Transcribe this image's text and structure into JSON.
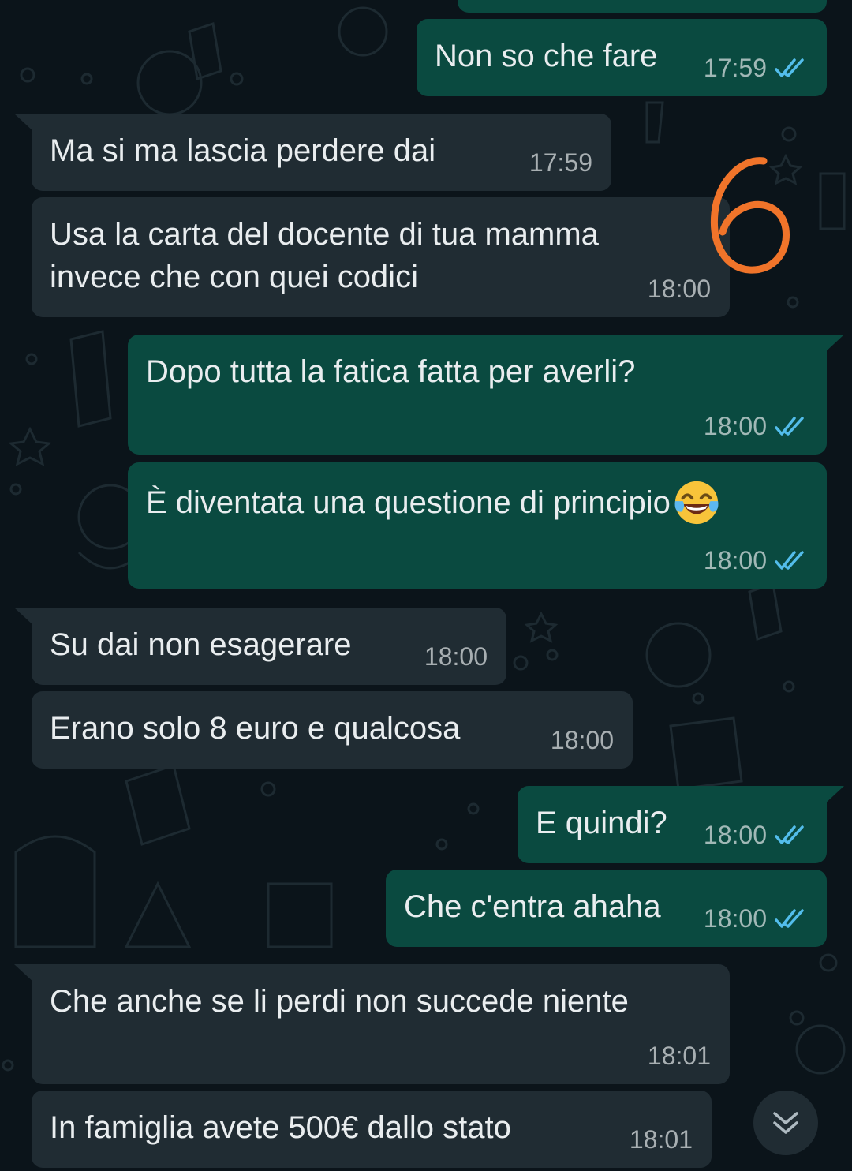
{
  "theme": {
    "background": "#0b141a",
    "incoming_bubble": "#202c33",
    "outgoing_bubble": "#0a4a40",
    "read_ticks": "#53bdeb",
    "annotation": "#f0742a"
  },
  "messages": [
    {
      "direction": "out",
      "text": "Non so che fare",
      "time": "17:59",
      "status": "read-ticks-icon"
    },
    {
      "direction": "in",
      "text": "Ma si ma lascia perdere dai",
      "time": "17:59"
    },
    {
      "direction": "in",
      "text_line1": "Usa la carta del docente di tua mamma",
      "text_line2": "invece che con quei codici",
      "time": "18:00"
    },
    {
      "direction": "out",
      "text": "Dopo tutta la fatica fatta per averli?",
      "time": "18:00",
      "status": "read-ticks-icon"
    },
    {
      "direction": "out",
      "text": "È diventata una questione di principio",
      "emoji": "laughing-tears-emoji",
      "time": "18:00",
      "status": "read-ticks-icon"
    },
    {
      "direction": "in",
      "text": "Su dai non esagerare",
      "time": "18:00"
    },
    {
      "direction": "in",
      "text": "Erano solo 8 euro e qualcosa",
      "time": "18:00"
    },
    {
      "direction": "out",
      "text": "E quindi?",
      "time": "18:00",
      "status": "read-ticks-icon"
    },
    {
      "direction": "out",
      "text": "Che c'entra ahaha",
      "time": "18:00",
      "status": "read-ticks-icon"
    },
    {
      "direction": "in",
      "text": "Che anche se li perdi non succede niente",
      "time": "18:01"
    },
    {
      "direction": "in",
      "text": "In famiglia avete 500€ dallo stato",
      "time": "18:01"
    }
  ],
  "scroll_button": {
    "icon": "double-chevron-down-icon"
  },
  "annotation": {
    "text": "6"
  }
}
